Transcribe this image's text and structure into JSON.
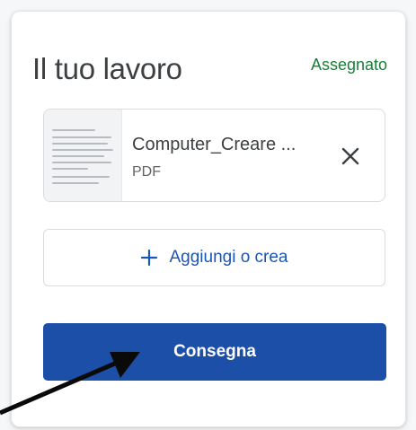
{
  "work_panel": {
    "title": "Il tuo lavoro",
    "status": "Assegnato",
    "attachment": {
      "file_name": "Computer_Creare ...",
      "file_type": "PDF",
      "thumbnail_icon": "document-thumbnail",
      "remove_icon": "close-icon"
    },
    "add_button": {
      "icon": "plus-icon",
      "label": "Aggiungi o crea"
    },
    "submit_button": {
      "label": "Consegna"
    },
    "annotation_icon": "arrow-icon"
  },
  "colors": {
    "status_green": "#188038",
    "accent_blue": "#1a56b8",
    "submit_bg": "#1c4fa8",
    "arrow": "#0a0a0a"
  }
}
